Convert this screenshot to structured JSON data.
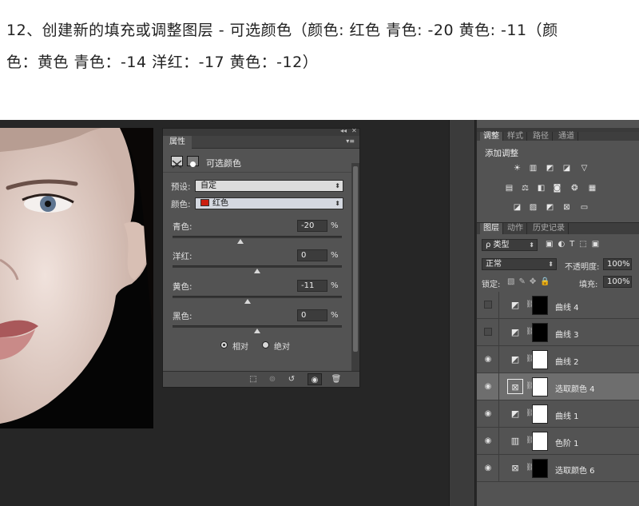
{
  "intro": {
    "line1": "12、创建新的填充或调整图层 - 可选颜色（颜色: 红色  青色: -20  黄色: -11（颜",
    "line2": "色：黄色  青色：-14  洋红：-17  黄色：-12）"
  },
  "properties_panel": {
    "tab_label": "属性",
    "collapse": "◂◂",
    "close": "✕",
    "title": "可选颜色",
    "preset_label": "预设:",
    "preset_value": "自定",
    "color_label": "颜色:",
    "color_value": "红色",
    "color_swatch": "#cc1f10",
    "sliders": [
      {
        "label": "青色:",
        "value": "-20",
        "unit": "%",
        "level": -0.2
      },
      {
        "label": "洋红:",
        "value": "0",
        "unit": "%",
        "level": 0
      },
      {
        "label": "黄色:",
        "value": "-11",
        "unit": "%",
        "level": -0.11
      },
      {
        "label": "黑色:",
        "value": "0",
        "unit": "%",
        "level": 0
      }
    ],
    "method": {
      "relative_label": "相对",
      "absolute_label": "绝对",
      "selected": "relative"
    }
  },
  "adjustments_panel": {
    "tabs": [
      "调整",
      "样式",
      "路径",
      "通道"
    ],
    "active_tab": "调整",
    "title": "添加调整"
  },
  "layers_panel": {
    "tabs": [
      "图层",
      "动作",
      "历史记录"
    ],
    "active_tab": "图层",
    "filter_label": "ρ 类型",
    "blend_mode": "正常",
    "opacity_label": "不透明度:",
    "opacity_value": "100%",
    "lock_label": "锁定:",
    "fill_label": "填充:",
    "fill_value": "100%",
    "layers": [
      {
        "name": "曲线 4",
        "visible": false,
        "icon": "curves-icon"
      },
      {
        "name": "曲线 3",
        "visible": false,
        "icon": "curves-icon"
      },
      {
        "name": "曲线 2",
        "visible": true,
        "icon": "curves-icon"
      },
      {
        "name": "选取颜色 4",
        "visible": true,
        "icon": "selective-color-icon",
        "selected": true
      },
      {
        "name": "曲线 1",
        "visible": true,
        "icon": "curves-icon"
      },
      {
        "name": "色阶 1",
        "visible": true,
        "icon": "levels-icon"
      },
      {
        "name": "选取颜色 6",
        "visible": true,
        "icon": "selective-color-icon"
      }
    ]
  }
}
